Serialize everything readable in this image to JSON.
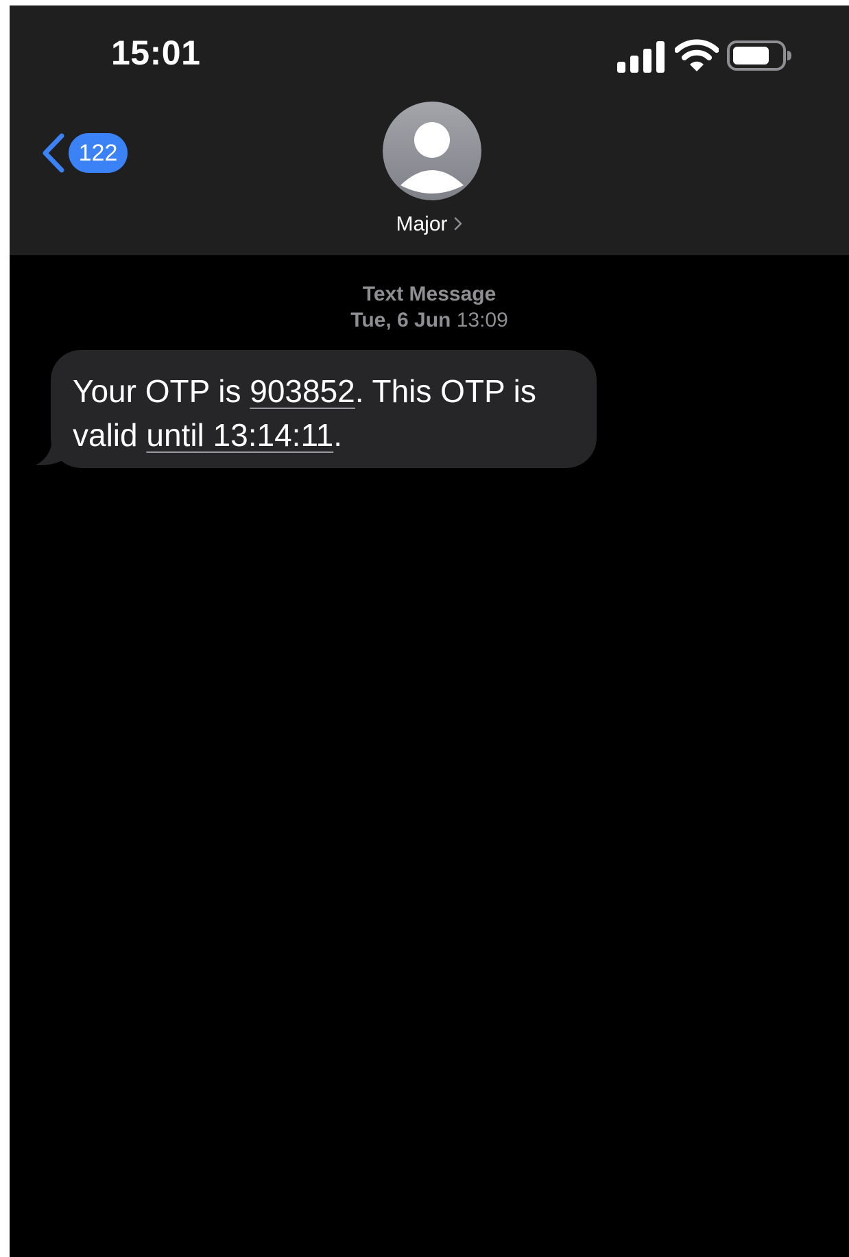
{
  "status_bar": {
    "time": "15:01",
    "icons": [
      "cellular-signal-icon",
      "wifi-icon",
      "battery-icon"
    ]
  },
  "nav": {
    "back_badge": "122",
    "back_icon": "chevron-left-icon",
    "contact_name": "Major",
    "contact_chevron_icon": "chevron-right-icon",
    "avatar_icon": "person-silhouette-icon"
  },
  "conversation": {
    "message_kind": "Text Message",
    "date_day": "Tue, 6 Jun",
    "date_time": "13:09"
  },
  "message": {
    "part1": "Your OTP is ",
    "otp_code": "903852",
    "part2": ". This OTP is",
    "part3": "valid ",
    "until_time": "until 13:14:11",
    "part4": "."
  },
  "colors": {
    "background": "#000000",
    "header": "#1f1f1f",
    "accent_blue": "#3b82f6",
    "bubble": "#262628",
    "meta_text": "#8e8e93"
  }
}
